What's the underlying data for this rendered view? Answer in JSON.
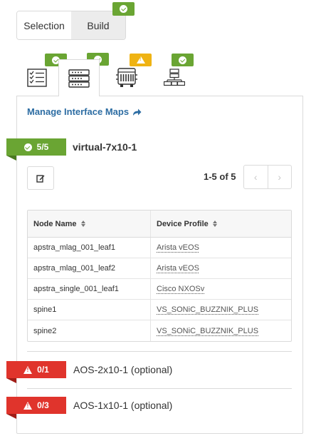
{
  "mode_toggle": {
    "options": [
      "Selection",
      "Build"
    ],
    "active": "Build",
    "build_status": "ok"
  },
  "step_tabs": [
    {
      "icon": "checklist-icon",
      "status": "ok",
      "active": false
    },
    {
      "icon": "server-rack-icon",
      "status": "ok",
      "active": true
    },
    {
      "icon": "device-chassis-icon",
      "status": "warning",
      "active": false
    },
    {
      "icon": "network-topology-icon",
      "status": "ok",
      "active": false
    }
  ],
  "manage_link": "Manage Interface Maps",
  "groups": [
    {
      "status": "ok",
      "count": "5/5",
      "title": "virtual-7x10-1"
    },
    {
      "status": "error",
      "count": "0/1",
      "title": "AOS-2x10-1 (optional)"
    },
    {
      "status": "error",
      "count": "0/3",
      "title": "AOS-1x10-1 (optional)"
    }
  ],
  "pager": {
    "label": "1-5 of 5",
    "prev": "‹",
    "next": "›"
  },
  "table": {
    "columns": [
      "Node Name",
      "Device Profile"
    ],
    "rows": [
      [
        "apstra_mlag_001_leaf1",
        "Arista vEOS"
      ],
      [
        "apstra_mlag_001_leaf2",
        "Arista vEOS"
      ],
      [
        "apstra_single_001_leaf1",
        "Cisco NXOSv"
      ],
      [
        "spine1",
        "VS_SONiC_BUZZNIK_PLUS"
      ],
      [
        "spine2",
        "VS_SONiC_BUZZNIK_PLUS"
      ]
    ]
  },
  "colors": {
    "ok": "#6aa533",
    "warning": "#efb313",
    "error": "#e0342c",
    "link": "#2d6da3"
  }
}
